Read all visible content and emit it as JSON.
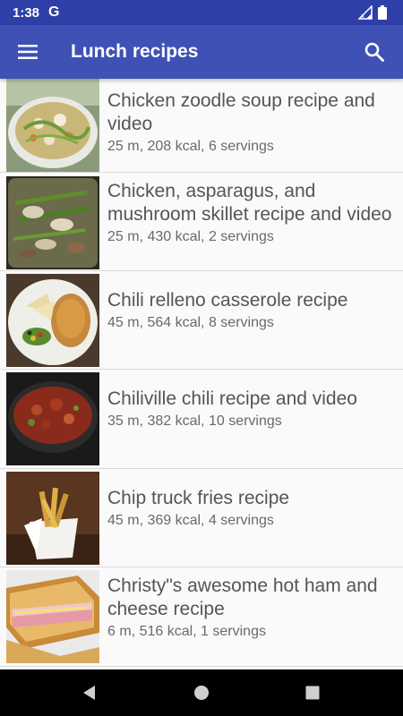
{
  "status_bar": {
    "time": "1:38",
    "g_label": "G"
  },
  "app_bar": {
    "title": "Lunch recipes",
    "menu_icon": "hamburger-menu-icon",
    "search_icon": "search-icon",
    "color": "#3f51b5"
  },
  "recipes": [
    {
      "title": "Chicken zoodle soup recipe and video",
      "meta": "25 m, 208 kcal, 6 servings"
    },
    {
      "title": "Chicken, asparagus, and mushroom skillet recipe and video",
      "meta": "25 m, 430 kcal, 2 servings"
    },
    {
      "title": "Chili relleno casserole recipe",
      "meta": "45 m, 564 kcal, 8 servings"
    },
    {
      "title": "Chiliville chili recipe and video",
      "meta": "35 m, 382 kcal, 10 servings"
    },
    {
      "title": "Chip truck fries recipe",
      "meta": "45 m, 369 kcal, 4 servings"
    },
    {
      "title": "Christy\"s awesome hot ham and cheese recipe",
      "meta": "6 m, 516 kcal, 1 servings"
    }
  ],
  "nav_bar": {
    "back_icon": "back-triangle-icon",
    "home_icon": "home-circle-icon",
    "recents_icon": "recents-square-icon"
  }
}
